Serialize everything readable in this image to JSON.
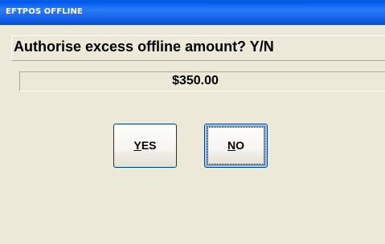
{
  "window": {
    "title": "EFTPOS OFFLINE"
  },
  "dialog": {
    "question": "Authorise excess offline amount? Y/N",
    "amount": "$350.00"
  },
  "buttons": {
    "yes": {
      "mnemonic": "Y",
      "rest": "ES"
    },
    "no": {
      "mnemonic": "N",
      "rest": "O",
      "focused": true
    }
  },
  "colors": {
    "titlebar": "#0058ee",
    "dialog_bg": "#ece9d8",
    "button_border": "#003c74",
    "focus_highlight": "#6a95e6"
  }
}
